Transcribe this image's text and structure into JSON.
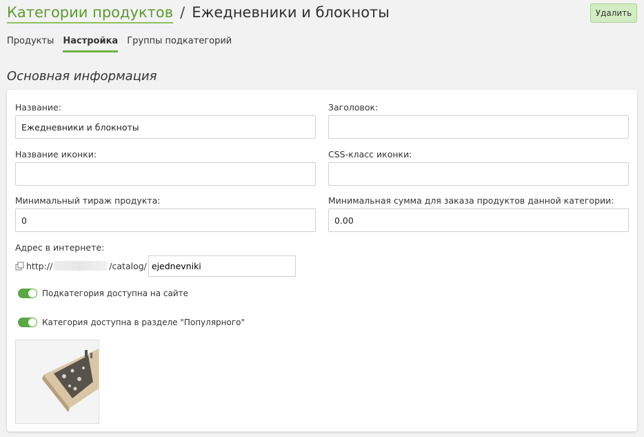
{
  "breadcrumb": {
    "parent": "Категории продуктов",
    "separator": "/",
    "current": "Ежедневники и блокноты"
  },
  "actions": {
    "delete_label": "Удалить"
  },
  "tabs": [
    {
      "label": "Продукты",
      "active": false
    },
    {
      "label": "Настройка",
      "active": true
    },
    {
      "label": "Группы подкатегорий",
      "active": false
    }
  ],
  "section_title": "Основная информация",
  "form": {
    "name": {
      "label": "Название:",
      "value": "Ежедневники и блокноты"
    },
    "heading": {
      "label": "Заголовок:",
      "value": ""
    },
    "icon_name": {
      "label": "Название иконки:",
      "value": ""
    },
    "icon_css": {
      "label": "CSS-класс иконки:",
      "value": ""
    },
    "min_run": {
      "label": "Минимальный тираж продукта:",
      "value": "0"
    },
    "min_sum": {
      "label": "Минимальная сумма для заказа продуктов данной категории:",
      "value": "0.00"
    },
    "url": {
      "label": "Адрес в интернете:",
      "prefix": "http://",
      "suffix": "/catalog/",
      "slug": "ejednevniki"
    }
  },
  "toggles": [
    {
      "label": "Подкатегория доступна на сайте",
      "on": true
    },
    {
      "label": "Категория доступна в разделе \"Популярного\"",
      "on": true
    }
  ],
  "colors": {
    "accent": "#6db33f",
    "link": "#5d9a2f",
    "button_bg": "#d3ecc4"
  }
}
